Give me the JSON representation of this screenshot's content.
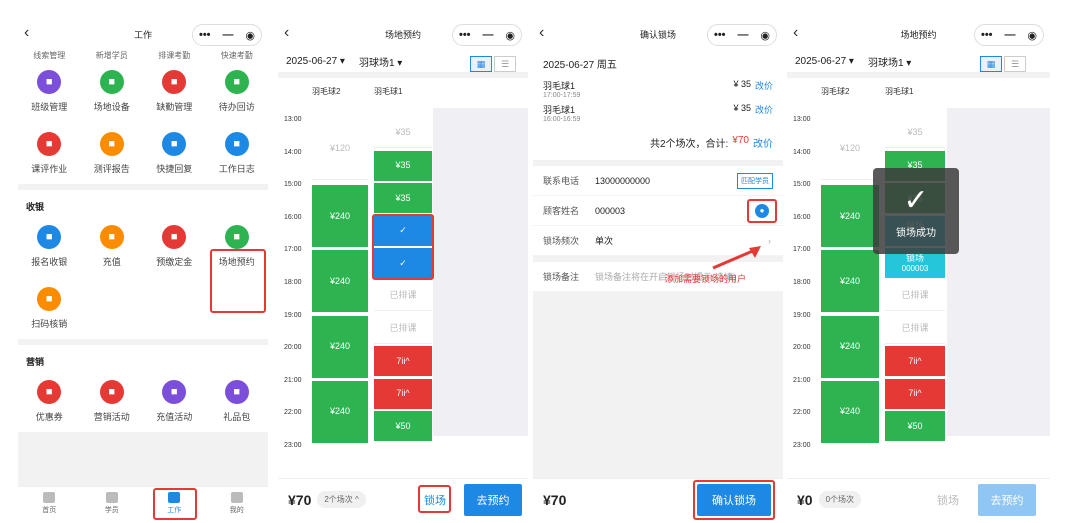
{
  "p1": {
    "title": "工作",
    "top_labels": [
      "线索管理",
      "新增学员",
      "排课考勤",
      "快速考勤"
    ],
    "row1": [
      {
        "label": "班级管理",
        "color": "#7b4fd9"
      },
      {
        "label": "场地设备",
        "color": "#2db451"
      },
      {
        "label": "缺勤管理",
        "color": "#e53935"
      },
      {
        "label": "待办回访",
        "color": "#2db451"
      }
    ],
    "row2": [
      {
        "label": "课评作业",
        "color": "#e53935"
      },
      {
        "label": "测评报告",
        "color": "#fb8c00"
      },
      {
        "label": "快捷回复",
        "color": "#1e88e5"
      },
      {
        "label": "工作日志",
        "color": "#1e88e5"
      }
    ],
    "sect_income": "收银",
    "income": [
      {
        "label": "报名收银",
        "color": "#1e88e5"
      },
      {
        "label": "充值",
        "color": "#fb8c00"
      },
      {
        "label": "预缴定金",
        "color": "#e53935"
      },
      {
        "label": "场地预约",
        "color": "#2db451"
      },
      {
        "label": "扫码核销",
        "color": "#fb8c00"
      }
    ],
    "sect_marketing": "营销",
    "marketing": [
      {
        "label": "优惠券",
        "color": "#e53935"
      },
      {
        "label": "营销活动",
        "color": "#e53935"
      },
      {
        "label": "充值活动",
        "color": "#7b4fd9"
      },
      {
        "label": "礼品包",
        "color": "#7b4fd9"
      }
    ],
    "tabs": [
      "首页",
      "学员",
      "工作",
      "我的"
    ]
  },
  "p2": {
    "title": "场地预约",
    "date": "2025-06-27 ▾",
    "venue": "羽球场1 ▾",
    "col1": "羽毛球2",
    "col2": "羽毛球1",
    "times": [
      "13:00",
      "14:00",
      "15:00",
      "16:00",
      "17:00",
      "18:00",
      "19:00",
      "20:00",
      "21:00",
      "22:00",
      "23:00"
    ],
    "b_120": "¥120",
    "b_240": "¥240",
    "b_35": "¥35",
    "scheduled": "已排课",
    "booked": "7ii^",
    "b_50": "¥50",
    "check": "✓",
    "total": "¥70",
    "count": "2个场次 ^",
    "lock": "锁场",
    "book": "去预约"
  },
  "p3": {
    "title": "确认锁场",
    "date": "2025-06-27 周五",
    "items": [
      {
        "name": "羽毛球1",
        "time": "17:00-17:59",
        "price": "¥ 35",
        "act": "改价"
      },
      {
        "name": "羽毛球1",
        "time": "16:00-16:59",
        "price": "¥ 35",
        "act": "改价"
      }
    ],
    "summary_pre": "共2个场次，合计:",
    "summary_amt": "¥70",
    "summary_act": "改价",
    "phone_label": "联系电话",
    "phone": "13000000000",
    "match": "匹配学员",
    "name_label": "顾客姓名",
    "name": "000003",
    "freq_label": "锁场频次",
    "freq": "单次",
    "note_label": "锁场备注",
    "note_ph": "锁场备注将在开启锁场时提示(选填)",
    "annotation": "添加需要锁场的用户",
    "total": "¥70",
    "confirm": "确认锁场"
  },
  "p4": {
    "title": "场地预约",
    "date": "2025-06-27 ▾",
    "venue": "羽球场1 ▾",
    "col1": "羽毛球2",
    "col2": "羽毛球1",
    "toast": "锁场成功",
    "locked": "锁场",
    "locked_user": "000003",
    "locked_user_faint": "000003",
    "total": "¥0",
    "count": "0个场次",
    "lock": "锁场",
    "book": "去预约"
  }
}
